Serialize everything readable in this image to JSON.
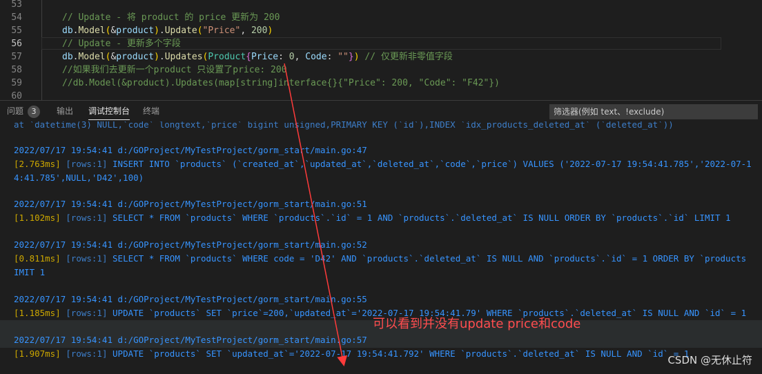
{
  "editor": {
    "lines": [
      {
        "num": "53",
        "segments": []
      },
      {
        "num": "54",
        "segments": [
          {
            "t": "// Update - 将 product 的 price 更新为 200",
            "c": "cmt"
          }
        ]
      },
      {
        "num": "55",
        "segments": [
          {
            "t": "db",
            "c": "var"
          },
          {
            "t": ".",
            "c": "pun"
          },
          {
            "t": "Model",
            "c": "fn"
          },
          {
            "t": "(",
            "c": "br1"
          },
          {
            "t": "&",
            "c": "pun"
          },
          {
            "t": "product",
            "c": "var"
          },
          {
            "t": ")",
            "c": "br1"
          },
          {
            "t": ".",
            "c": "pun"
          },
          {
            "t": "Update",
            "c": "fn"
          },
          {
            "t": "(",
            "c": "br1"
          },
          {
            "t": "\"Price\"",
            "c": "str"
          },
          {
            "t": ", ",
            "c": "pun"
          },
          {
            "t": "200",
            "c": "num"
          },
          {
            "t": ")",
            "c": "br1"
          }
        ]
      },
      {
        "num": "56",
        "current": true,
        "segments": [
          {
            "t": "// Update - 更新多个字段",
            "c": "cmt"
          }
        ]
      },
      {
        "num": "57",
        "segments": [
          {
            "t": "db",
            "c": "var"
          },
          {
            "t": ".",
            "c": "pun"
          },
          {
            "t": "Model",
            "c": "fn"
          },
          {
            "t": "(",
            "c": "br1"
          },
          {
            "t": "&",
            "c": "pun"
          },
          {
            "t": "product",
            "c": "var"
          },
          {
            "t": ")",
            "c": "br1"
          },
          {
            "t": ".",
            "c": "pun"
          },
          {
            "t": "Updates",
            "c": "fn"
          },
          {
            "t": "(",
            "c": "br1"
          },
          {
            "t": "Product",
            "c": "typ"
          },
          {
            "t": "{",
            "c": "br2"
          },
          {
            "t": "Price",
            "c": "var"
          },
          {
            "t": ": ",
            "c": "pun"
          },
          {
            "t": "0",
            "c": "num"
          },
          {
            "t": ", ",
            "c": "pun"
          },
          {
            "t": "Code",
            "c": "var"
          },
          {
            "t": ": ",
            "c": "pun"
          },
          {
            "t": "\"\"",
            "c": "str"
          },
          {
            "t": "}",
            "c": "br2"
          },
          {
            "t": ")",
            "c": "br1"
          },
          {
            "t": " // 仅更新非零值字段",
            "c": "cmt"
          }
        ]
      },
      {
        "num": "58",
        "segments": [
          {
            "t": "//如果我们去更新一个product 只设置了price: 200",
            "c": "cmt"
          }
        ]
      },
      {
        "num": "59",
        "segments": [
          {
            "t": "//db.Model(&product).Updates(map[string]interface{}{\"Price\": 200, \"Code\": \"F42\"})",
            "c": "cmt"
          }
        ]
      },
      {
        "num": "60",
        "segments": []
      }
    ]
  },
  "panel": {
    "tabs": {
      "problems": "问题",
      "problems_count": "3",
      "output": "输出",
      "debug_console": "调试控制台",
      "terminal": "终端"
    },
    "filter_placeholder": "筛选器(例如 text、!exclude)"
  },
  "console": {
    "truncated_top": "at `datetime(3) NULL,`code` longtext,`price` bigint unsigned,PRIMARY KEY (`id`),INDEX `idx_products_deleted_at` (`deleted_at`))",
    "entries": [
      {
        "header": "2022/07/17 19:54:41 d:/GOProject/MyTestProject/gorm_start/main.go:47",
        "time": "[2.763ms]",
        "rows": "[rows:1]",
        "sql": "INSERT INTO `products` (`created_at`,`updated_at`,`deleted_at`,`code`,`price`) VALUES ('2022-07-17 19:54:41.785','2022-07-1",
        "wrap": "4:41.785',NULL,'D42',100)"
      },
      {
        "header": "2022/07/17 19:54:41 d:/GOProject/MyTestProject/gorm_start/main.go:51",
        "time": "[1.102ms]",
        "rows": "[rows:1]",
        "sql": "SELECT * FROM `products` WHERE `products`.`id` = 1 AND `products`.`deleted_at` IS NULL ORDER BY `products`.`id` LIMIT 1",
        "wrap": ""
      },
      {
        "header": "2022/07/17 19:54:41 d:/GOProject/MyTestProject/gorm_start/main.go:52",
        "time": "[0.811ms]",
        "rows": "[rows:1]",
        "sql": "SELECT * FROM `products` WHERE code = 'D42' AND `products`.`deleted_at` IS NULL AND `products`.`id` = 1 ORDER BY `products",
        "wrap": "IMIT 1"
      },
      {
        "header": "2022/07/17 19:54:41 d:/GOProject/MyTestProject/gorm_start/main.go:55",
        "time": "[1.185ms]",
        "rows": "[rows:1]",
        "sql": "UPDATE `products` SET `price`=200,`updated_at`='2022-07-17 19:54:41.79' WHERE `products`.`deleted_at` IS NULL AND `id` = 1",
        "wrap": ""
      },
      {
        "header": "2022/07/17 19:54:41 d:/GOProject/MyTestProject/gorm_start/main.go:57",
        "time": "[1.907ms]",
        "rows": "[rows:1]",
        "sql": "UPDATE `products` SET `updated_at`='2022-07-17 19:54:41.792' WHERE `products`.`deleted_at` IS NULL AND `id` = 1",
        "wrap": ""
      }
    ]
  },
  "annotation": {
    "text": "可以看到并没有update price和code",
    "color": "#ff4d4f"
  },
  "watermark": "CSDN @无休止符"
}
